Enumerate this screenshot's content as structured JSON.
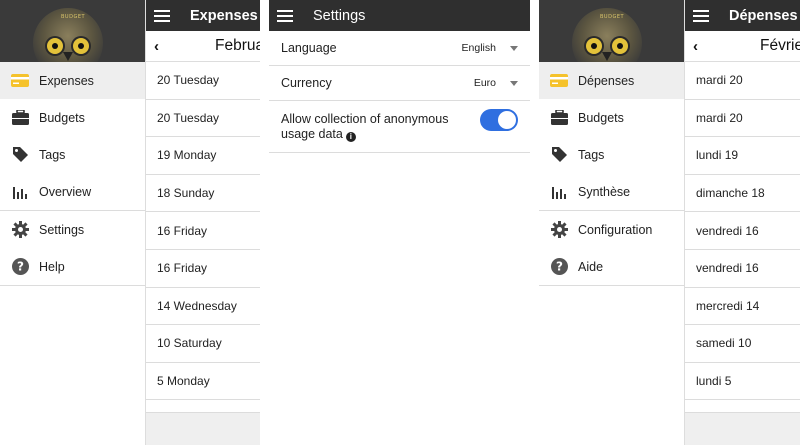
{
  "colors": {
    "accent": "#2f6fe0",
    "appbar": "#2f2f2f",
    "active_item": "#eeeeee",
    "card_icon": "#f5c22b"
  },
  "en": {
    "drawer": {
      "logo_text": "BUDGET",
      "items": [
        {
          "label": "Expenses",
          "icon": "credit-card-icon"
        },
        {
          "label": "Budgets",
          "icon": "briefcase-icon"
        },
        {
          "label": "Tags",
          "icon": "tag-icon"
        },
        {
          "label": "Overview",
          "icon": "bar-chart-icon"
        },
        {
          "label": "Settings",
          "icon": "gear-icon"
        },
        {
          "label": "Help",
          "icon": "help-icon"
        }
      ]
    },
    "expenses": {
      "title": "Expenses",
      "month": "February",
      "rows": [
        "20 Tuesday",
        "20 Tuesday",
        "19 Monday",
        "18 Sunday",
        "16 Friday",
        "16 Friday",
        "14 Wednesday",
        "10 Saturday",
        "5 Monday"
      ]
    },
    "settings": {
      "title": "Settings",
      "language_label": "Language",
      "language_value": "English",
      "currency_label": "Currency",
      "currency_value": "Euro",
      "anon_label_line1": "Allow collection of anonymous",
      "anon_label_line2": "usage data",
      "anon_info": "i"
    }
  },
  "fr": {
    "drawer": {
      "logo_text": "BUDGET",
      "items": [
        {
          "label": "Dépenses",
          "icon": "credit-card-icon"
        },
        {
          "label": "Budgets",
          "icon": "briefcase-icon"
        },
        {
          "label": "Tags",
          "icon": "tag-icon"
        },
        {
          "label": "Synthèse",
          "icon": "bar-chart-icon"
        },
        {
          "label": "Configuration",
          "icon": "gear-icon"
        },
        {
          "label": "Aide",
          "icon": "help-icon"
        }
      ]
    },
    "expenses": {
      "title": "Dépenses",
      "month": "Février",
      "rows": [
        "mardi 20",
        "mardi 20",
        "lundi 19",
        "dimanche 18",
        "vendredi 16",
        "vendredi 16",
        "mercredi 14",
        "samedi 10",
        "lundi 5"
      ]
    }
  }
}
